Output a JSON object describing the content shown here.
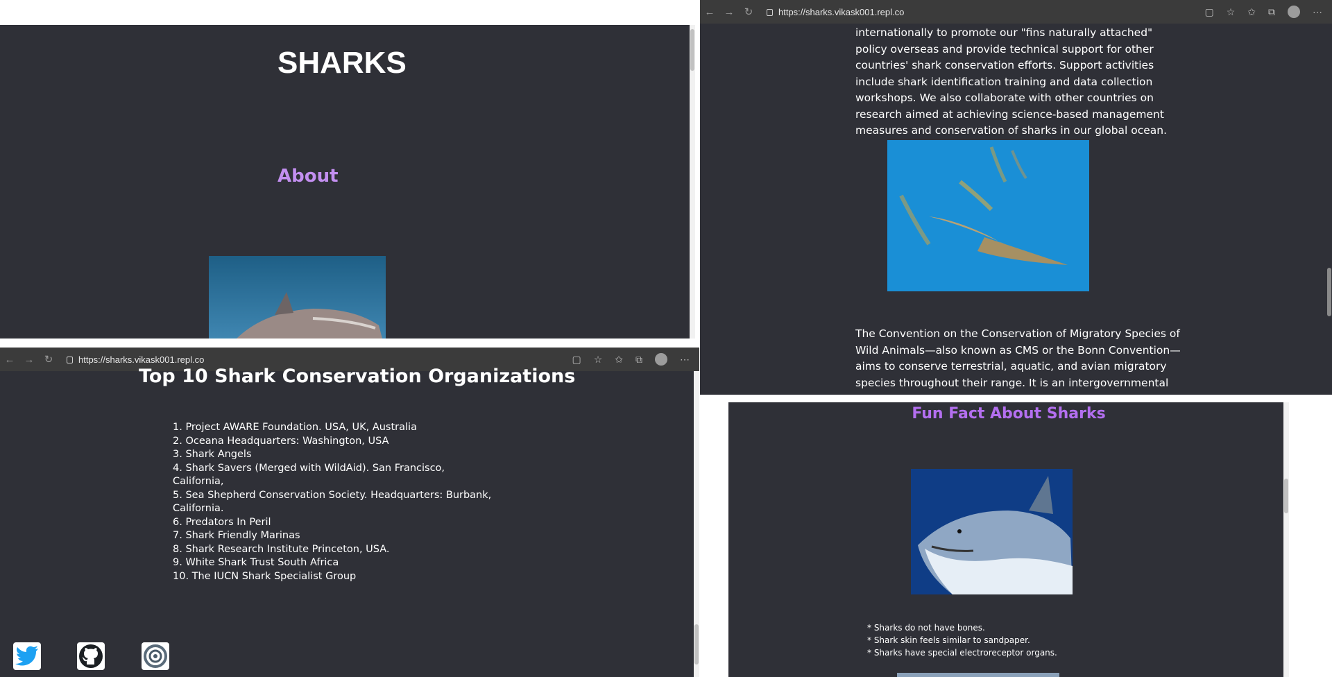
{
  "browser": {
    "url": "https://sharks.vikask001.repl.co"
  },
  "top_left": {
    "title": "SHARKS",
    "about_heading": "About"
  },
  "top_right": {
    "paragraph1": "internationally to promote our \"fins naturally attached\" policy overseas and provide technical support for other countries' shark conservation efforts. Support activities include shark identification training and data collection workshops. We also collaborate with other countries on research aimed at achieving science-based management measures and conservation of sharks in our global ocean.",
    "paragraph2": "The Convention on the Conservation of Migratory Species of Wild Animals—also known as CMS or the Bonn Convention— aims to conserve terrestrial, aquatic, and avian migratory species throughout their range. It is an intergovernmental treaty, backed by the United"
  },
  "bottom_left": {
    "heading": "Top 10 Shark Conservation Organizations",
    "organizations": [
      "1. Project AWARE Foundation. USA, UK, Australia",
      "2. Oceana Headquarters: Washington, USA",
      "3. Shark Angels",
      "4. Shark Savers (Merged with WildAid). San Francisco, California,",
      "5. Sea Shepherd Conservation Society. Headquarters: Burbank, California.",
      "6. Predators In Peril",
      "7. Shark Friendly Marinas",
      "8. Shark Research Institute Princeton, USA.",
      "9. White Shark Trust South Africa",
      "10. The IUCN Shark Specialist Group"
    ],
    "social_icons": [
      "twitter-icon",
      "github-icon",
      "replit-icon"
    ]
  },
  "bottom_right": {
    "heading": "Fun Fact About Sharks",
    "facts": [
      "* Sharks do not have bones.",
      "* Shark skin feels similar to sandpaper.",
      "* Sharks have special electroreceptor organs."
    ]
  },
  "colors": {
    "page_bg": "#2f3037",
    "about_heading": "#c38ff0",
    "fun_heading": "#b46ff0",
    "twitter": "#1da1f2"
  }
}
